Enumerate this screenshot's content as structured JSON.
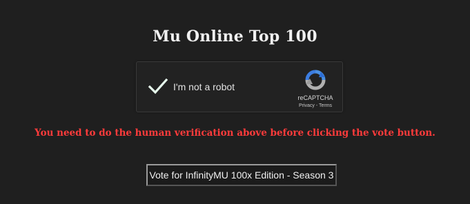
{
  "page": {
    "title": "Mu Online Top 100",
    "warning": "You need to do the human verification above before clicking the vote button."
  },
  "recaptcha": {
    "label": "I'm not a robot",
    "checked": true,
    "brand": "reCAPTCHA",
    "privacy_link": "Privacy",
    "separator": " - ",
    "terms_link": "Terms",
    "checkmark_color": "#e6f7ec"
  },
  "vote_button": {
    "label": "Vote for InfinityMU 100x Edition - Season 3"
  },
  "colors": {
    "background": "#1f1f1f",
    "warning_text": "#ff3b3b",
    "recaptcha_blue": "#4a90e2",
    "recaptcha_gray": "#b0b0b0"
  }
}
